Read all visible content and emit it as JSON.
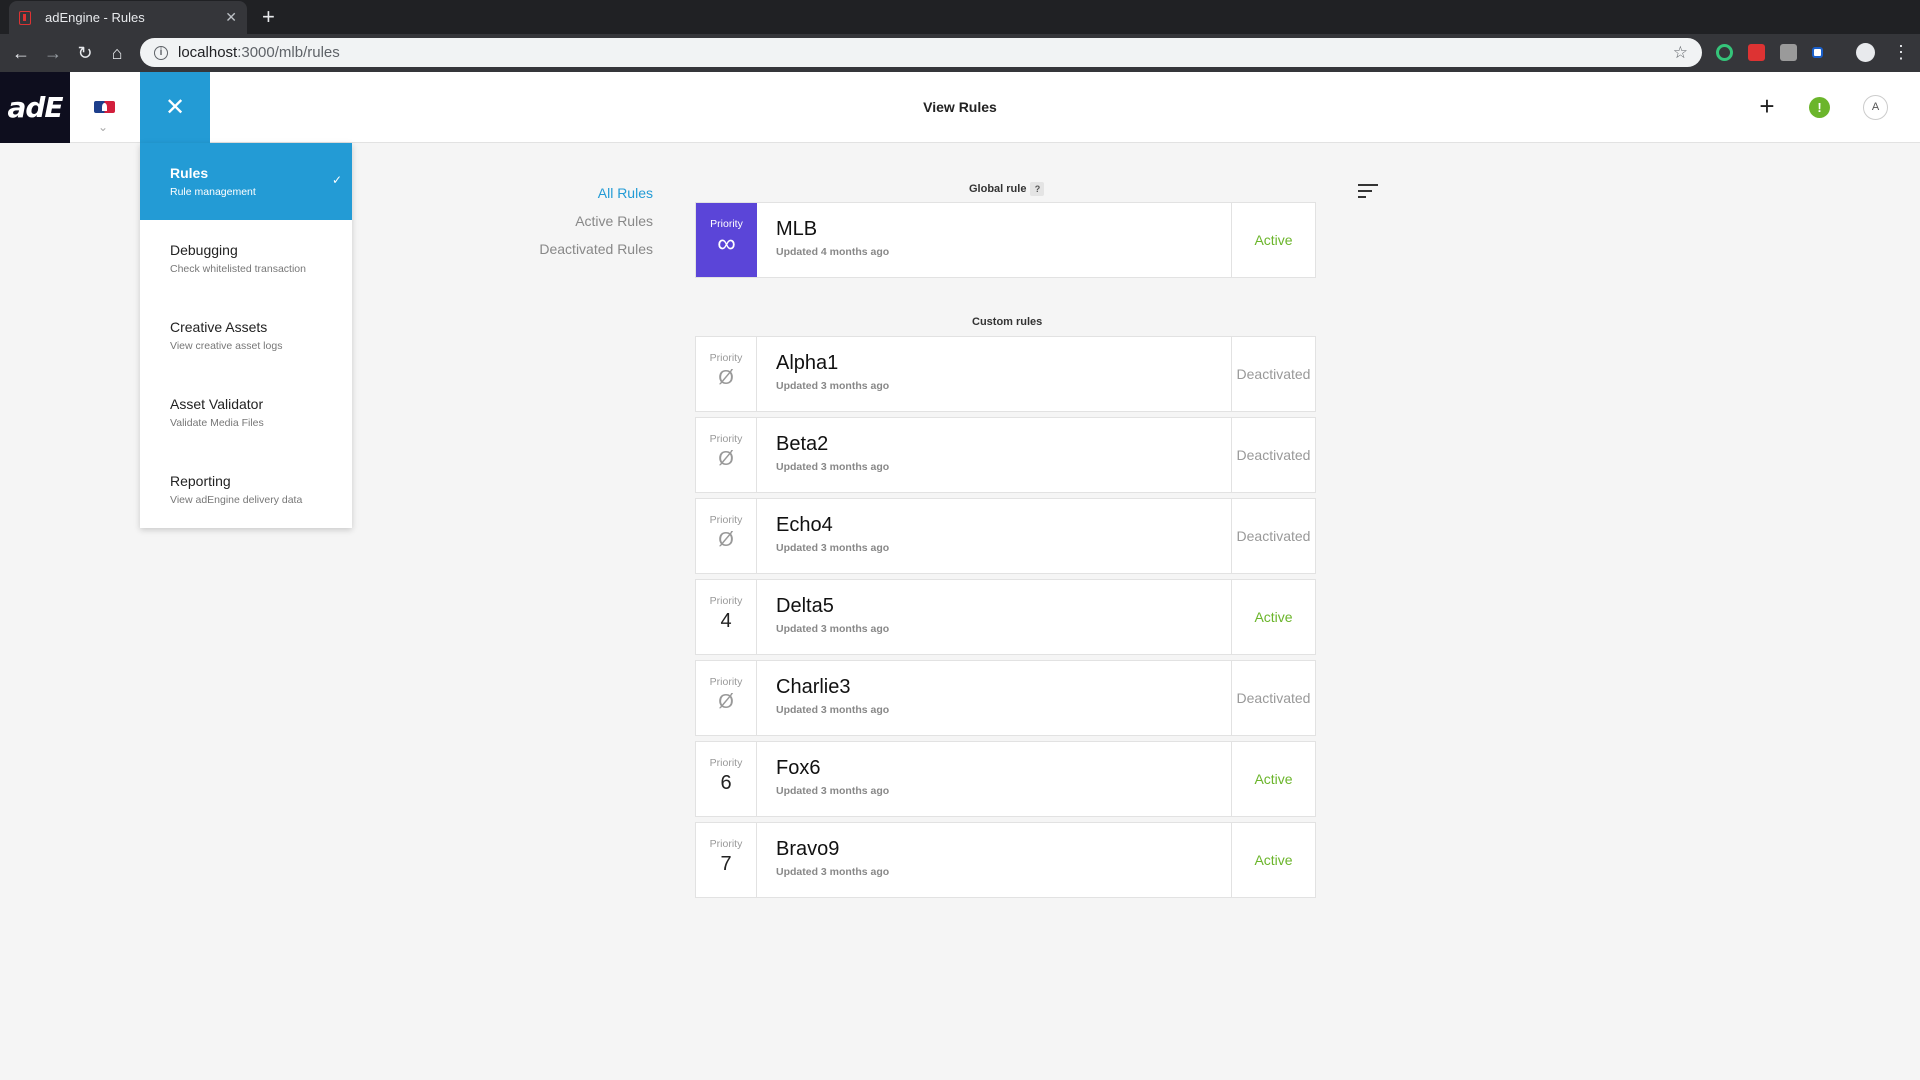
{
  "browser": {
    "tab_title": "adEngine - Rules",
    "new_tab": "+",
    "url_host": "localhost",
    "url_path": ":3000/mlb/rules"
  },
  "header": {
    "logo": "adE",
    "title": "View Rules",
    "add": "+",
    "alert": "!",
    "avatar": "A",
    "close": "✕"
  },
  "menu": {
    "items": [
      {
        "label": "Rules",
        "sub": "Rule management"
      },
      {
        "label": "Debugging",
        "sub": "Check whitelisted transaction"
      },
      {
        "label": "Creative Assets",
        "sub": "View creative asset logs"
      },
      {
        "label": "Asset Validator",
        "sub": "Validate Media Files"
      },
      {
        "label": "Reporting",
        "sub": "View adEngine delivery data"
      }
    ]
  },
  "filters": {
    "all": "All Rules",
    "active": "Active Rules",
    "deactivated": "Deactivated Rules"
  },
  "global": {
    "label": "Global rule",
    "help": "?",
    "rule": {
      "priority_label": "Priority",
      "priority": "∞",
      "name": "MLB",
      "updated": "Updated 4 months ago",
      "status": "Active"
    }
  },
  "custom": {
    "label": "Custom rules",
    "rules": [
      {
        "priority_label": "Priority",
        "priority": "Ø",
        "name": "Alpha1",
        "updated": "Updated 3 months ago",
        "status": "Deactivated"
      },
      {
        "priority_label": "Priority",
        "priority": "Ø",
        "name": "Beta2",
        "updated": "Updated 3 months ago",
        "status": "Deactivated"
      },
      {
        "priority_label": "Priority",
        "priority": "Ø",
        "name": "Echo4",
        "updated": "Updated 3 months ago",
        "status": "Deactivated"
      },
      {
        "priority_label": "Priority",
        "priority": "4",
        "name": "Delta5",
        "updated": "Updated 3 months ago",
        "status": "Active"
      },
      {
        "priority_label": "Priority",
        "priority": "Ø",
        "name": "Charlie3",
        "updated": "Updated 3 months ago",
        "status": "Deactivated"
      },
      {
        "priority_label": "Priority",
        "priority": "6",
        "name": "Fox6",
        "updated": "Updated 3 months ago",
        "status": "Active"
      },
      {
        "priority_label": "Priority",
        "priority": "7",
        "name": "Bravo9",
        "updated": "Updated 3 months ago",
        "status": "Active"
      }
    ]
  },
  "colors": {
    "accent": "#239bd5",
    "global_priority": "#5b45d8",
    "active": "#6bb52b",
    "deactivated": "#999999"
  }
}
